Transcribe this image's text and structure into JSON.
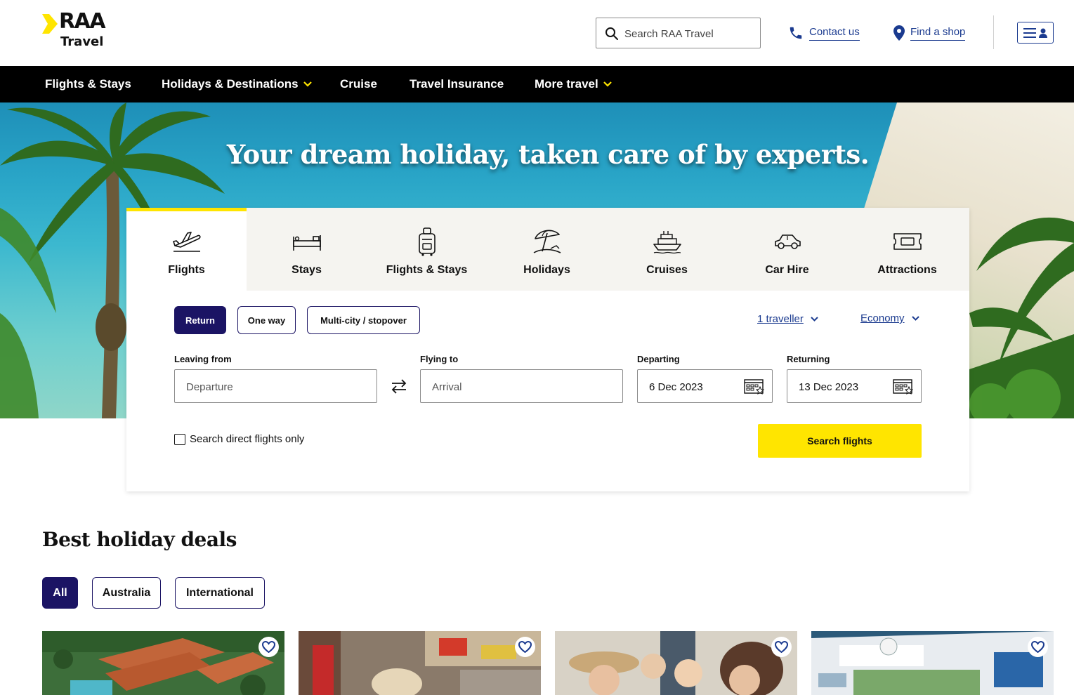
{
  "brand": {
    "logo_top": "RAA",
    "logo_bottom": "Travel",
    "accent_yellow": "#ffe500",
    "navy": "#1b1464",
    "link_blue": "#1a3a8f"
  },
  "header": {
    "search_placeholder": "Search RAA Travel",
    "contact_label": "Contact us",
    "find_shop_label": "Find a shop"
  },
  "nav": {
    "items": [
      {
        "label": "Flights & Stays",
        "has_dropdown": false
      },
      {
        "label": "Holidays & Destinations",
        "has_dropdown": true
      },
      {
        "label": "Cruise",
        "has_dropdown": false
      },
      {
        "label": "Travel Insurance",
        "has_dropdown": false
      },
      {
        "label": "More travel",
        "has_dropdown": true
      }
    ]
  },
  "hero": {
    "title": "Your dream holiday, taken care of by experts."
  },
  "search": {
    "tabs": [
      {
        "label": "Flights",
        "icon": "plane-takeoff-icon",
        "active": true
      },
      {
        "label": "Stays",
        "icon": "bed-icon",
        "active": false
      },
      {
        "label": "Flights & Stays",
        "icon": "suitcase-icon",
        "active": false
      },
      {
        "label": "Holidays",
        "icon": "beach-umbrella-icon",
        "active": false
      },
      {
        "label": "Cruises",
        "icon": "cruise-ship-icon",
        "active": false
      },
      {
        "label": "Car Hire",
        "icon": "car-icon",
        "active": false
      },
      {
        "label": "Attractions",
        "icon": "ticket-icon",
        "active": false
      }
    ],
    "trip_types": [
      {
        "label": "Return",
        "selected": true
      },
      {
        "label": "One way",
        "selected": false
      },
      {
        "label": "Multi-city / stopover",
        "selected": false
      }
    ],
    "travellers": "1 traveller",
    "cabin_class": "Economy",
    "leaving_from": {
      "label": "Leaving from",
      "placeholder": "Departure",
      "value": ""
    },
    "flying_to": {
      "label": "Flying to",
      "placeholder": "Arrival",
      "value": ""
    },
    "departing": {
      "label": "Departing",
      "value": "6 Dec 2023"
    },
    "returning": {
      "label": "Returning",
      "value": "13 Dec 2023"
    },
    "direct_only_label": "Search direct flights only",
    "direct_only_checked": false,
    "submit_label": "Search flights"
  },
  "deals": {
    "title": "Best holiday deals",
    "filters": [
      {
        "label": "All",
        "selected": true
      },
      {
        "label": "Australia",
        "selected": false
      },
      {
        "label": "International",
        "selected": false
      }
    ],
    "cards": [
      {
        "image": "resort-aerial-photo",
        "favourite": false
      },
      {
        "image": "street-market-photo",
        "favourite": false
      },
      {
        "image": "friends-drinks-photo",
        "favourite": false
      },
      {
        "image": "cruise-ship-deck-photo",
        "favourite": false
      }
    ]
  }
}
